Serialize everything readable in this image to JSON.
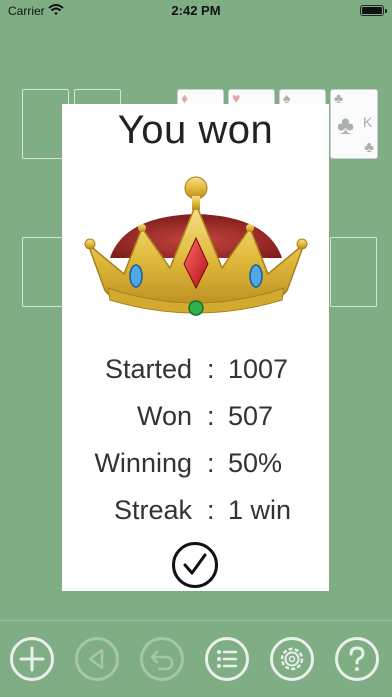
{
  "status_bar": {
    "carrier": "Carrier",
    "time": "2:42 PM"
  },
  "dialog": {
    "title": "You won",
    "stats": [
      {
        "label": "Started",
        "value": "1007"
      },
      {
        "label": "Won",
        "value": "507"
      },
      {
        "label": "Winning",
        "value": "50%"
      },
      {
        "label": "Streak",
        "value": "1 win"
      }
    ],
    "separator": ":",
    "confirm_icon": "checkmark-circle-icon"
  },
  "toolbar": {
    "buttons": [
      {
        "name": "new-game",
        "icon": "plus-icon",
        "enabled": true
      },
      {
        "name": "back",
        "icon": "triangle-left-icon",
        "enabled": false
      },
      {
        "name": "undo",
        "icon": "undo-arrow-icon",
        "enabled": false
      },
      {
        "name": "menu",
        "icon": "list-icon",
        "enabled": true
      },
      {
        "name": "settings",
        "icon": "gear-icon",
        "enabled": true
      },
      {
        "name": "help",
        "icon": "question-icon",
        "enabled": true
      }
    ]
  },
  "cards": {
    "foundation_club": "K"
  },
  "colors": {
    "felt": "#7fad84",
    "dialog_bg": "#ffffff",
    "toolbar_icon": "#e9f0ea",
    "toolbar_icon_disabled": "#a6c6a9"
  }
}
